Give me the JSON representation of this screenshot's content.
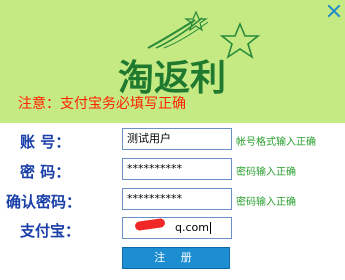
{
  "logo": {
    "text": "淘返利"
  },
  "notice": "注意：支付宝务必填写正确",
  "form": {
    "account": {
      "label": "账  号：",
      "value": "测试用户",
      "hint": "帐号格式输入正确"
    },
    "password": {
      "label": "密  码：",
      "value": "**********",
      "hint": "密码输入正确"
    },
    "confirm": {
      "label": "确认密码：",
      "value": "**********",
      "hint": "密码输入正确"
    },
    "alipay": {
      "label": "支付宝：",
      "value_visible": "q.com"
    }
  },
  "submit_label": "注 册",
  "colors": {
    "banner": "#c5ea83",
    "label": "#1a3fa8",
    "hint": "#2aa030",
    "notice": "#ff2200",
    "button": "#1c8ed1"
  }
}
